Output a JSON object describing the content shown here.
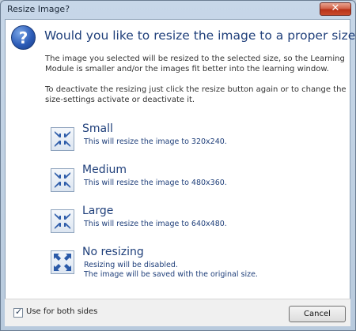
{
  "window": {
    "title": "Resize Image?",
    "close_label": "✕"
  },
  "question_icon_glyph": "?",
  "heading": "Would you like to resize the image to a proper size?",
  "description": {
    "para1_line1": "The image you selected will be resized to the selected size, so the Learning",
    "para1_line2": "Module is smaller and/or the images fit better into the learning window.",
    "para2_line1": "To deactivate the resizing just click the resize button again or to change the",
    "para2_line2": "size-settings activate or deactivate it."
  },
  "options": [
    {
      "title": "Small",
      "line1": "This will resize the image to 320x240.",
      "line2": "",
      "icon": "shrink-arrows-icon"
    },
    {
      "title": "Medium",
      "line1": "This will resize the image to 480x360.",
      "line2": "",
      "icon": "shrink-arrows-icon"
    },
    {
      "title": "Large",
      "line1": "This will resize the image to 640x480.",
      "line2": "",
      "icon": "shrink-arrows-icon"
    },
    {
      "title": "No resizing",
      "line1": "Resizing will be disabled.",
      "line2": "The image will be saved with the original size.",
      "icon": "expand-arrows-icon"
    }
  ],
  "footer": {
    "checkbox_label": "Use for both sides",
    "checkbox_checked": true,
    "check_glyph": "✓",
    "cancel_label": "Cancel"
  },
  "colors": {
    "accent": "#1f3f7a",
    "icon_blue": "#2d5db8"
  }
}
